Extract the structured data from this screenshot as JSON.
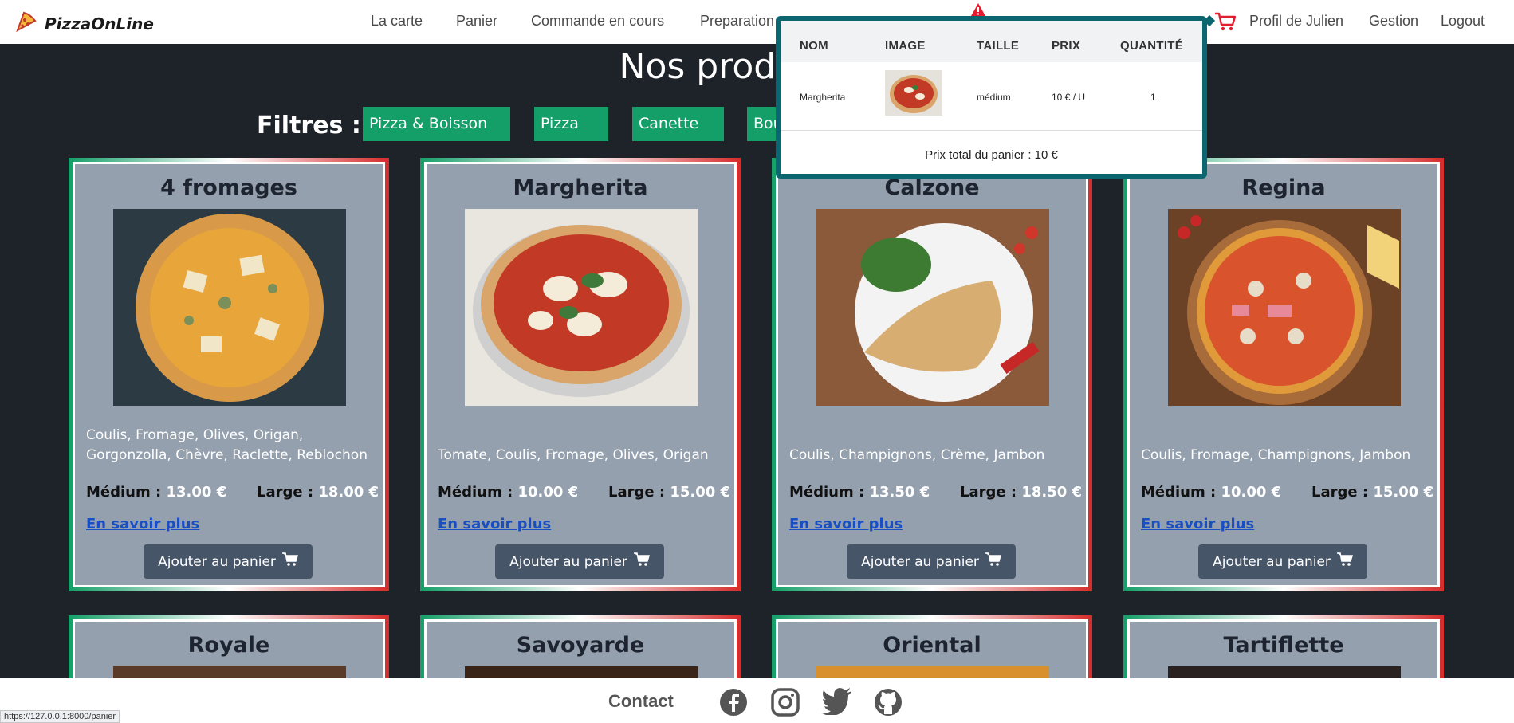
{
  "brand": {
    "name": "PizzaOnLine"
  },
  "nav": {
    "la_carte": "La carte",
    "panier": "Panier",
    "commande": "Commande en cours",
    "preparation": "Preparation",
    "profil": "Profil de Julien",
    "gestion": "Gestion",
    "logout": "Logout"
  },
  "page": {
    "title": "Nos produits",
    "filters_label": "Filtres :"
  },
  "filters": [
    "Pizza & Boisson",
    "Pizza",
    "Canette",
    "Bouteille"
  ],
  "products": [
    {
      "name": "4 fromages",
      "desc": "Coulis, Fromage, Olives, Origan, Gorgonzolla, Chèvre, Raclette, Reblochon",
      "medium_label": "Médium",
      "medium": "13.00 €",
      "large_label": "Large",
      "large": "18.00 €",
      "more": "En savoir plus",
      "add": "Ajouter au panier"
    },
    {
      "name": "Margherita",
      "desc": "Tomate, Coulis, Fromage, Olives, Origan",
      "medium_label": "Médium",
      "medium": "10.00 €",
      "large_label": "Large",
      "large": "15.00 €",
      "more": "En savoir plus",
      "add": "Ajouter au panier"
    },
    {
      "name": "Calzone",
      "desc": "Coulis, Champignons, Crème, Jambon",
      "medium_label": "Médium",
      "medium": "13.50 €",
      "large_label": "Large",
      "large": "18.50 €",
      "more": "En savoir plus",
      "add": "Ajouter au panier"
    },
    {
      "name": "Regina",
      "desc": "Coulis, Fromage, Champignons, Jambon",
      "medium_label": "Médium",
      "medium": "10.00 €",
      "large_label": "Large",
      "large": "15.00 €",
      "more": "En savoir plus",
      "add": "Ajouter au panier"
    }
  ],
  "products_row2": [
    "Royale",
    "Savoyarde",
    "Oriental",
    "Tartiflette"
  ],
  "cart": {
    "headers": {
      "nom": "NOM",
      "image": "IMAGE",
      "taille": "TAILLE",
      "prix": "PRIX",
      "quantite": "QUANTITÉ"
    },
    "item": {
      "nom": "Margherita",
      "taille": "médium",
      "prix": "10 € / U",
      "quantite": "1"
    },
    "total": "Prix total du panier : 10 €"
  },
  "footer": {
    "contact": "Contact"
  },
  "status_url": "https://127.0.0.1:8000/panier",
  "colors": {
    "accent_green": "#159f68",
    "popup_border": "#0b6670",
    "cart_red": "#e11d2f",
    "link_blue": "#1a4fc4"
  },
  "icons": [
    "pizza-logo-icon",
    "cart-icon",
    "alert-icon",
    "shopping-cart-icon",
    "facebook-icon",
    "instagram-icon",
    "twitter-icon",
    "github-icon"
  ]
}
